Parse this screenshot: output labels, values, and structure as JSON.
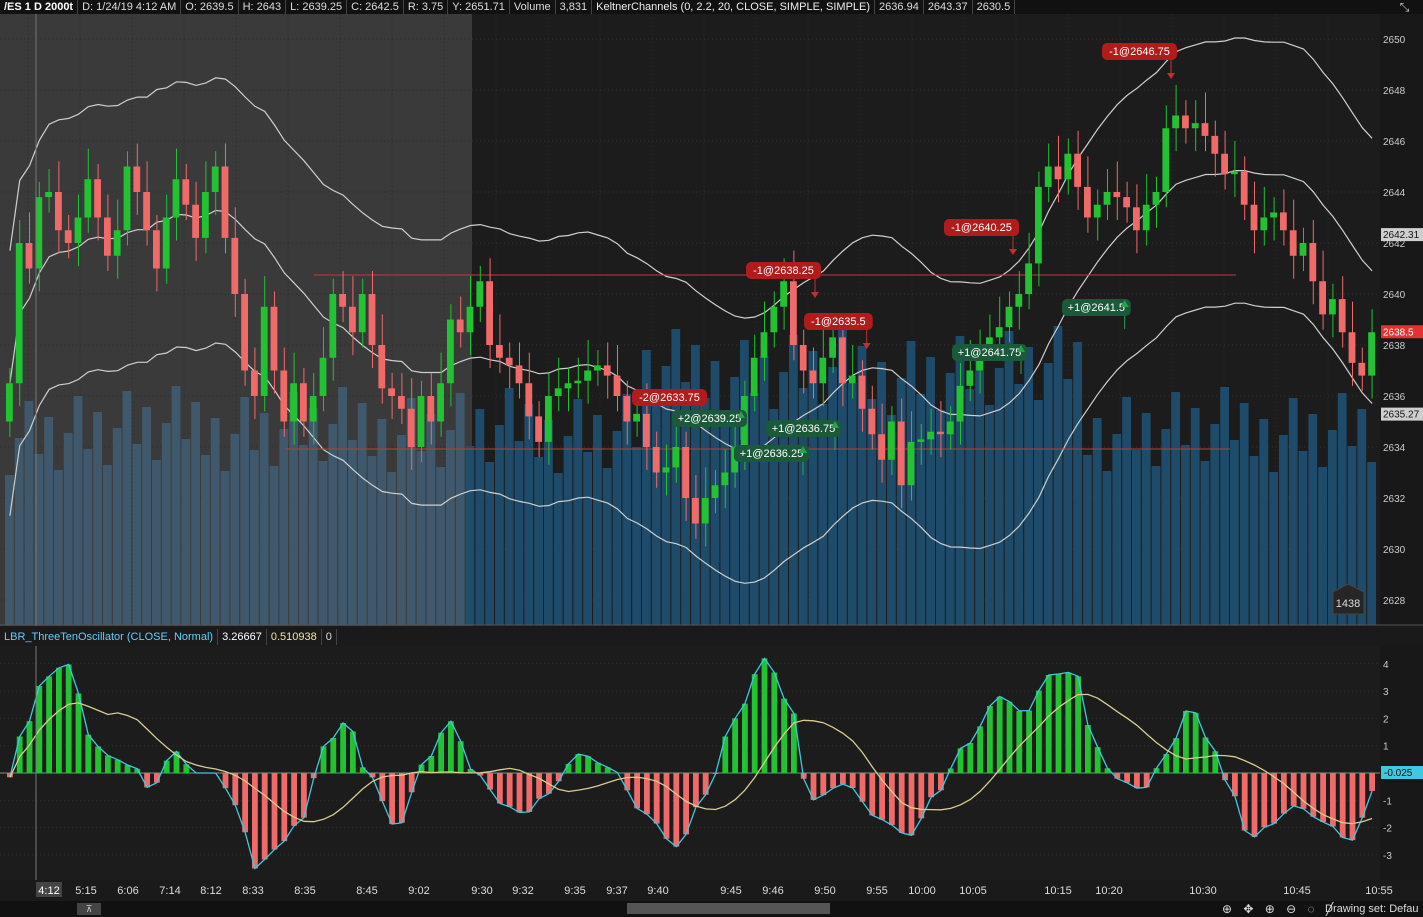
{
  "header": {
    "symbol": "/ES 1 D 2000t",
    "date": "D: 1/24/19 4:12 AM",
    "open": "O: 2639.5",
    "high": "H: 2643",
    "low": "L: 2639.25",
    "close": "C: 2642.5",
    "range": "R: 3.75",
    "y": "Y: 2651.71",
    "volume_label": "Volume",
    "volume_value": "3,831",
    "keltner_label": "KeltnerChannels (0, 2.2, 20, CLOSE, SIMPLE, SIMPLE)",
    "keltner_mid": "2636.94",
    "keltner_up": "2643.37",
    "keltner_low": "2630.5"
  },
  "price_axis": {
    "labels": [
      "2650",
      "2648",
      "2646",
      "2644",
      "2642",
      "2640",
      "2638",
      "2636",
      "2634",
      "2632",
      "2630",
      "2628"
    ],
    "upper_badge": "2642.31",
    "last_badge": "2638.5",
    "lower_badge": "2635.27",
    "volume_badge": "1438",
    "colors": {
      "last": "#e83030",
      "badge": "#cfcfcf"
    }
  },
  "trade_labels": [
    {
      "text": "-1@2646.75",
      "kind": "sell"
    },
    {
      "text": "-1@2640.25",
      "kind": "sell"
    },
    {
      "text": "-1@2638.25",
      "kind": "sell"
    },
    {
      "text": "-1@2635.5",
      "kind": "sell"
    },
    {
      "text": "-2@2633.75",
      "kind": "sell"
    },
    {
      "text": "+2@2639.25",
      "kind": "buy"
    },
    {
      "text": "+1@2636.75",
      "kind": "buy"
    },
    {
      "text": "+1@2636.25",
      "kind": "buy"
    },
    {
      "text": "+1@2641.75",
      "kind": "buy"
    },
    {
      "text": "+1@2641.5",
      "kind": "buy"
    }
  ],
  "oscillator": {
    "name": "LBR_ThreeTenOscillator (CLOSE, Normal)",
    "value1": "3.26667",
    "value2": "0.510938",
    "value3": "0",
    "axis_labels": [
      "4",
      "3",
      "2",
      "1",
      "-1",
      "-2",
      "-3"
    ],
    "zero_badge": "-0.025"
  },
  "time_axis": {
    "cursor": "4:12",
    "labels": [
      "5:15",
      "6:06",
      "7:14",
      "8:12",
      "8:33",
      "8:35",
      "8:45",
      "9:02",
      "9:30",
      "9:32",
      "9:35",
      "9:37",
      "9:40",
      "9:45",
      "9:46",
      "9:50",
      "9:55",
      "10:00",
      "10:05",
      "10:15",
      "10:20",
      "10:30",
      "10:45",
      "10:55"
    ]
  },
  "footer": {
    "drawing_set": "Drawing set: Defau",
    "tools": "⊕ ✥ ⊕ ⊖ ◌ ╱",
    "scroll_icon": "⊼",
    "corner_icon": "⤡"
  },
  "colors": {
    "up": "#22c232",
    "down": "#f06a6a",
    "volume": "#1d4e6e",
    "sell_label": "#b01c1c",
    "buy_label": "#1a5a3a",
    "osc_line": "#3fc8e0",
    "osc_signal": "#d8cc90"
  }
}
